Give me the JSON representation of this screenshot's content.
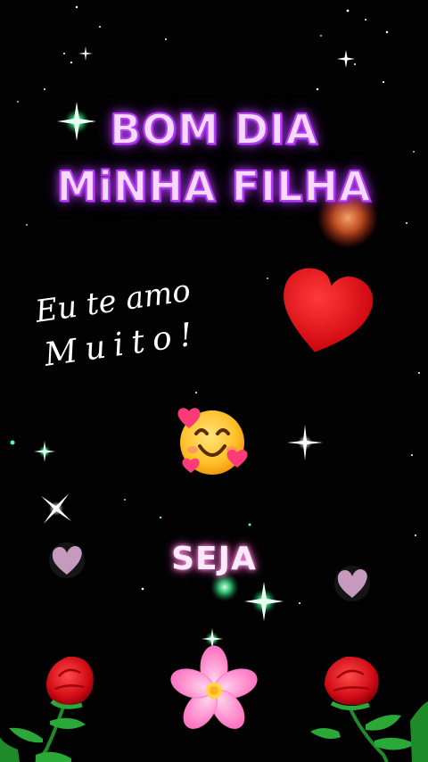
{
  "greeting": {
    "line1": "BOM DIA",
    "line2": "MiNHA FILHA"
  },
  "message": {
    "line1": "Eu te amo",
    "line2": "Muito!"
  },
  "footer_word": "SEJA",
  "colors": {
    "background": "#020202",
    "title_fill": "#f7d8ff",
    "title_glow": "#b23ff0",
    "heart": "#e8121a",
    "rose": "#e0101a",
    "flower": "#ff8ed0",
    "emoji_face": "#ffc83a"
  },
  "icons": [
    "red-heart-icon",
    "smiling-face-with-hearts-icon",
    "red-rose-icon",
    "pink-flower-icon",
    "sparkle-icon",
    "small-heart-icon"
  ]
}
